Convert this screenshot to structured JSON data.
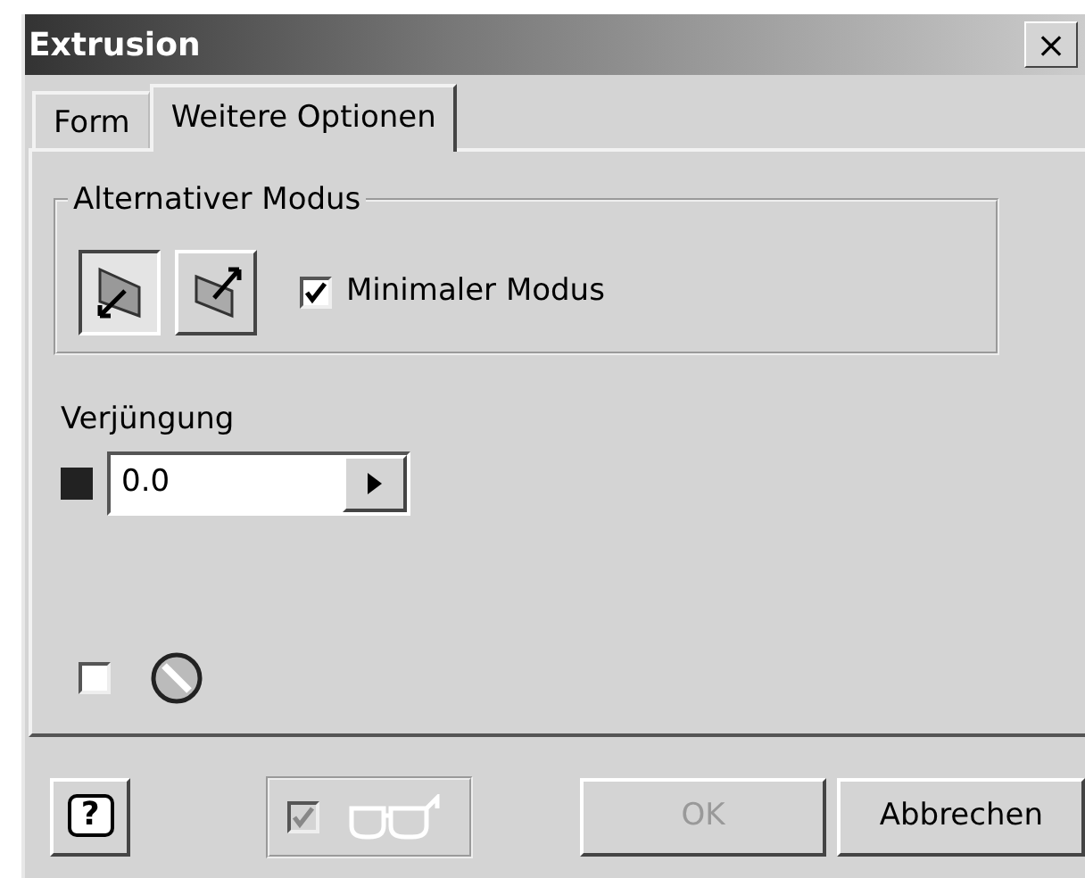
{
  "window": {
    "title": "Extrusion",
    "close": "×"
  },
  "tabs": [
    {
      "label": "Form",
      "selected": false
    },
    {
      "label": "Weitere Optionen",
      "selected": true
    }
  ],
  "group": {
    "title": "Alternativer Modus",
    "modes": [
      {
        "selected": true
      },
      {
        "selected": false
      }
    ],
    "checkbox": {
      "label": "Minimaler Modus",
      "checked": true
    }
  },
  "taper": {
    "label": "Verjüngung",
    "value": "0.0"
  },
  "extra_checkbox": {
    "checked": false
  },
  "footer": {
    "help": "?",
    "preview": {
      "checked": true,
      "disabled": true
    },
    "buttons": [
      {
        "label": "OK",
        "disabled": true
      },
      {
        "label": "Abbrechen",
        "disabled": false
      }
    ]
  }
}
